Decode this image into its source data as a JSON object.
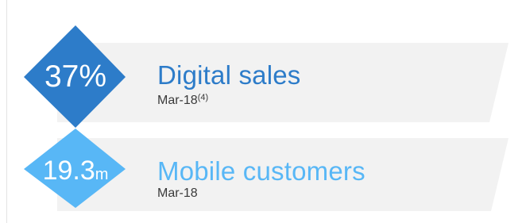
{
  "colors": {
    "band": "#f2f2f2",
    "divider": "#e3e3e3",
    "digital_accent": "#2d7cc9",
    "mobile_accent": "#58b7f6",
    "subtitle": "#3a3a3a"
  },
  "metrics": [
    {
      "value": "37%",
      "unit": "",
      "title": "Digital sales",
      "date": "Mar-18",
      "footnote": "(4)"
    },
    {
      "value": "19.3",
      "unit": "m",
      "title": "Mobile customers",
      "date": "Mar-18",
      "footnote": ""
    }
  ]
}
